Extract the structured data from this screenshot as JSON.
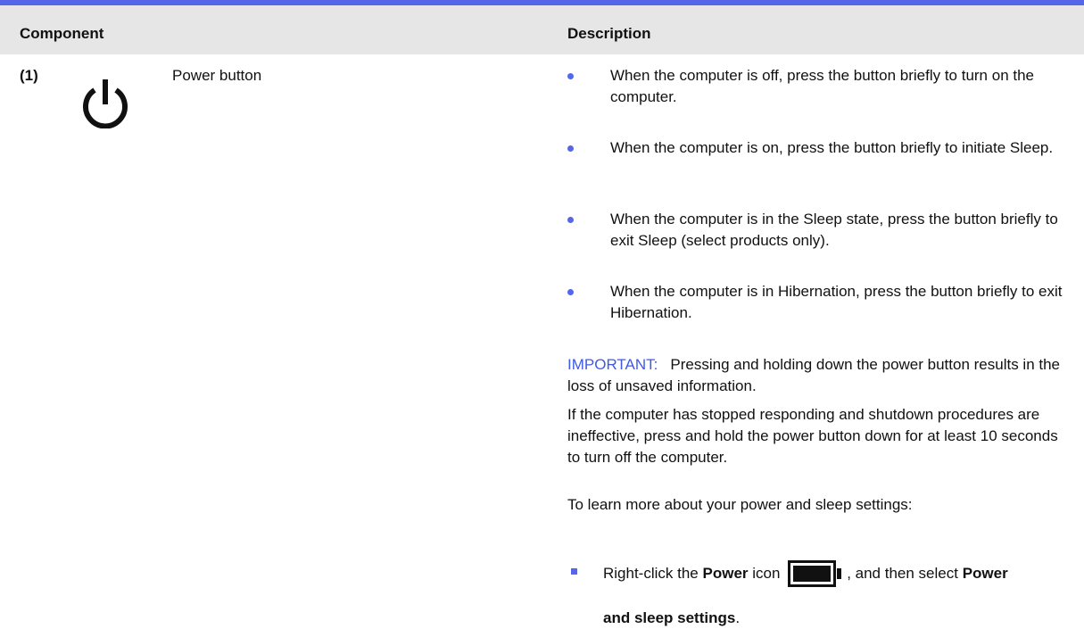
{
  "table": {
    "headers": {
      "component": "Component",
      "description": "Description"
    },
    "row": {
      "number": "(1)",
      "component_icon": "power-icon",
      "component_name": "Power button",
      "bullets": [
        "When the computer is off, press the button briefly to turn on the computer.",
        "When the computer is on, press the button briefly to initiate Sleep.",
        "When the computer is in the Sleep state, press the button briefly to exit Sleep (select products only).",
        "When the computer is in Hibernation, press the button briefly to exit Hibernation."
      ],
      "important_label": "IMPORTANT:",
      "important_text": "Pressing and holding down the power button results in the loss of unsaved information.",
      "stopped_responding_text": "If the computer has stopped responding and shutdown procedures are ineffective, press and hold the power button down for at least 10 seconds to turn off the computer.",
      "learn_more_text": "To learn more about your power and sleep settings:",
      "step": {
        "prefix": "Right-click the",
        "power_word": "Power",
        "icon_word": "icon",
        "icon": "battery-icon",
        "middle": ", and then select",
        "setting_part1": "Power",
        "setting_part2": "and sleep settings",
        "end": "."
      }
    }
  },
  "colors": {
    "accent": "#5566e8",
    "important": "#3f5ae6",
    "header_bg": "#e6e6e6"
  }
}
